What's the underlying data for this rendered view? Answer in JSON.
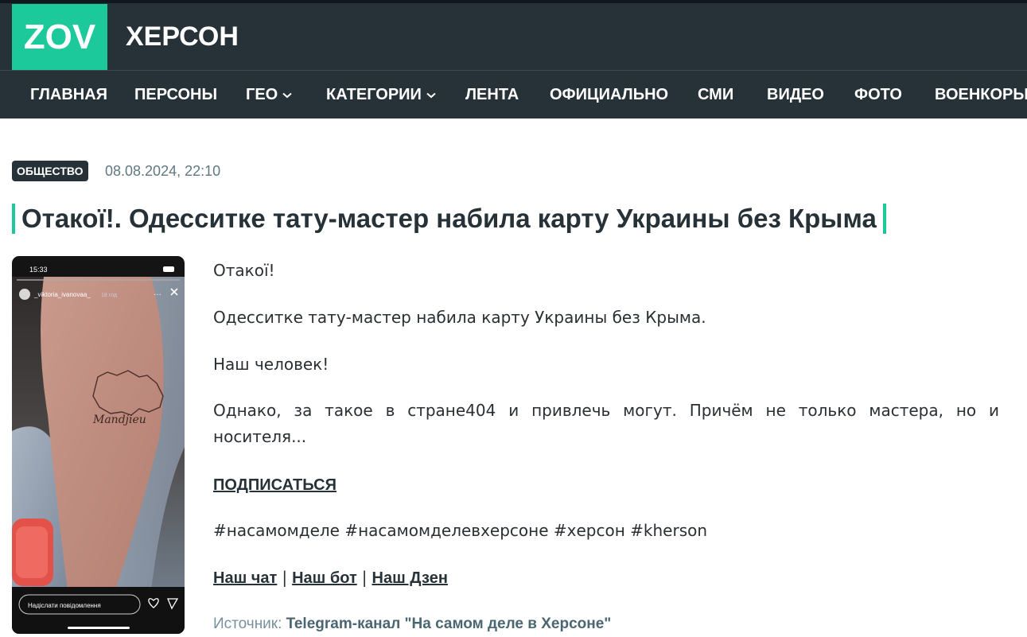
{
  "site": {
    "logo": "ZOV",
    "title": "ХЕРСОН"
  },
  "nav": {
    "items": [
      {
        "label": "ГЛАВНАЯ"
      },
      {
        "label": "ПЕРСОНЫ"
      },
      {
        "label": "ГЕО"
      },
      {
        "label": "КАТЕГОРИИ"
      },
      {
        "label": "ЛЕНТА"
      },
      {
        "label": "ОФИЦИАЛЬНО"
      },
      {
        "label": "СМИ"
      },
      {
        "label": "ВИДЕО"
      },
      {
        "label": "ФОТО"
      },
      {
        "label": "ВОЕНКОРЫ"
      }
    ]
  },
  "article": {
    "category": "ОБЩЕСТВО",
    "date": "08.08.2024, 22:10",
    "title": "Отакої!. Одесситке тату-мастер набила карту Украины без Крыма",
    "paragraphs": [
      "Отакої!",
      "Одесситке тату-мастер набила карту Украины без Крыма.",
      "Наш человек!",
      "Однако, за такое в стране404 и привлечь могут. Причём не только мастера, но и носителя..."
    ],
    "subscribe": "ПОДПИСАТЬСЯ",
    "hashtags": "#насамомделе #насамомделевхерсоне #херсон #kherson",
    "links": {
      "chat": "Наш чат",
      "bot": "Наш бот",
      "dzen": "Наш Дзен",
      "separator": "|"
    },
    "source_label": "Источник:",
    "source_name": "Telegram-канал \"На самом деле в Херсоне\""
  },
  "photo": {
    "time": "15:33",
    "username": "_viktoria_ivanovaa_",
    "age": "18 год",
    "message_placeholder": "Надіслати повідомлення",
    "tattoo_text": "Mandjieu"
  },
  "colors": {
    "accent": "#1bc99a",
    "header_bg": "#263238"
  }
}
